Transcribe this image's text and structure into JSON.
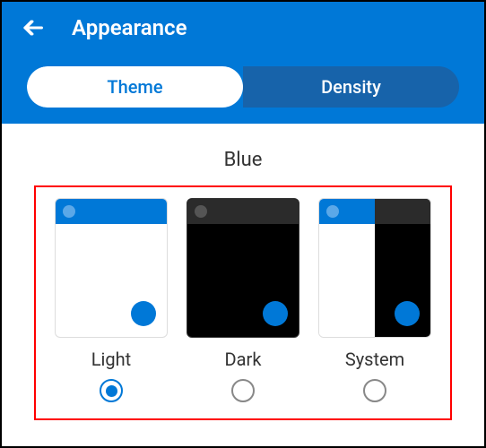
{
  "header": {
    "title": "Appearance"
  },
  "tabs": {
    "theme": "Theme",
    "density": "Density"
  },
  "section": {
    "color_label": "Blue"
  },
  "options": {
    "light": "Light",
    "dark": "Dark",
    "system": "System"
  }
}
